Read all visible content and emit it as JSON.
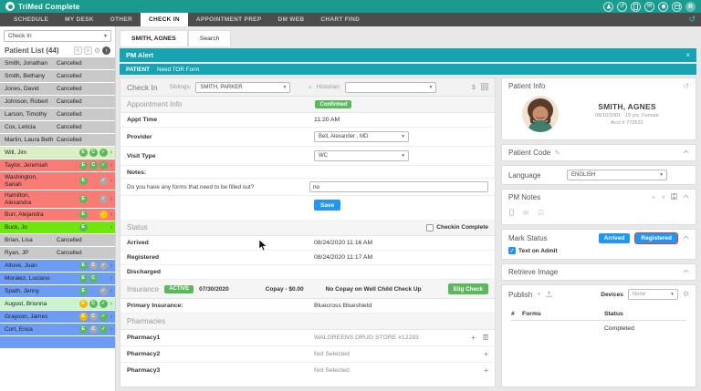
{
  "app": {
    "title": "TriMed Complete",
    "avatar": "R",
    "nav": [
      {
        "label": "SCHEDULE",
        "active": false
      },
      {
        "label": "MY DESK",
        "active": false
      },
      {
        "label": "OTHER",
        "active": false
      },
      {
        "label": "CHECK IN",
        "active": true
      },
      {
        "label": "APPOINTMENT PREP",
        "active": false
      },
      {
        "label": "DM WEB",
        "active": false
      },
      {
        "label": "CHART FIND",
        "active": false
      }
    ]
  },
  "icons": {
    "chevron_left": "‹",
    "chevron_right": "›",
    "gear": "⚙",
    "plus": "+",
    "close": "×",
    "dollar": "$",
    "edit": "✎",
    "mail": "✉",
    "mail_check": "☑",
    "history": "↺",
    "check": "✓",
    "caret": "▾",
    "chevron_up": "⌃"
  },
  "colors": {
    "rows": {
      "gray": "#c9c9c9",
      "red": "#f97b76",
      "lightgreen": "#daf0c4",
      "brightgreen": "#6fe70e",
      "palegreen": "#c9f4cf",
      "blue": "#6d9cf5"
    },
    "badges": {
      "green": "#5cb85c",
      "gray": "#a8a8a8",
      "orange": "#ffb300",
      "yellow": "#ffc107"
    },
    "accent_teal": "#1a9b8d",
    "alert_teal": "#17a3b2",
    "button_blue": "#2196f3",
    "button_green": "#5cb85c",
    "highlight_red": "#e53935"
  },
  "sidebar": {
    "filter_value": "Check In",
    "title": "Patient List (44)",
    "patients": [
      {
        "name": "Smith, Jonathan",
        "status": "Cancelled",
        "color": "gray"
      },
      {
        "name": "Smith, Bethany",
        "status": "Cancelled",
        "color": "gray"
      },
      {
        "name": "Jones, David",
        "status": "Cancelled",
        "color": "gray"
      },
      {
        "name": "Johnson, Robert",
        "status": "Cancelled",
        "color": "gray"
      },
      {
        "name": "Larson, Timothy",
        "status": "Cancelled",
        "color": "gray"
      },
      {
        "name": "Cox, Leticia",
        "status": "Cancelled",
        "color": "gray"
      },
      {
        "name": "Martin, Laura Beth",
        "status": "Cancelled",
        "color": "gray"
      },
      {
        "name": "Will, Jim",
        "color": "lightgreen",
        "arrow": true,
        "badges": [
          {
            "g": "E",
            "c": "green"
          },
          {
            "g": "C",
            "c": "green"
          },
          {
            "g": "check",
            "c": "green"
          }
        ]
      },
      {
        "name": "Taylor, Jeremiah",
        "color": "red",
        "arrow": true,
        "badges": [
          {
            "g": "E",
            "c": "green"
          },
          {
            "g": "C",
            "c": "green"
          },
          {
            "g": "check",
            "c": "green"
          }
        ]
      },
      {
        "name": "Washington, Sariah",
        "color": "red",
        "arrow": true,
        "badges": [
          {
            "g": "E",
            "c": "green"
          },
          null,
          {
            "g": "check",
            "c": "gray"
          }
        ]
      },
      {
        "name": "Hamilton, Alexandra",
        "color": "red",
        "arrow": true,
        "badges": [
          {
            "g": "E",
            "c": "green"
          },
          null,
          {
            "g": "check",
            "c": "gray"
          }
        ]
      },
      {
        "name": "Burr, Alejandra",
        "color": "red",
        "arrow": true,
        "badges": [
          {
            "g": "E",
            "c": "green"
          },
          null,
          {
            "g": "check",
            "c": "yellow"
          }
        ]
      },
      {
        "name": "Buck, Jo",
        "color": "brightgreen",
        "arrow": true,
        "badges": [
          {
            "g": "E",
            "c": "green"
          },
          null,
          null
        ]
      },
      {
        "name": "Brian, Lisa",
        "status": "Cancelled",
        "color": "gray"
      },
      {
        "name": "Ryan, JP",
        "status": "Cancelled",
        "color": "gray"
      },
      {
        "name": "Altuve, Juan",
        "color": "blue",
        "arrow": true,
        "badges": [
          {
            "g": "E",
            "c": "green"
          },
          {
            "g": "C",
            "c": "gray"
          },
          {
            "g": "check",
            "c": "gray"
          }
        ]
      },
      {
        "name": "Moralez, Luciano",
        "color": "blue",
        "arrow": true,
        "badges": [
          {
            "g": "E",
            "c": "green"
          },
          {
            "g": "C",
            "c": "green"
          },
          null
        ]
      },
      {
        "name": "Spath, Jenny",
        "color": "blue",
        "arrow": true,
        "badges": [
          {
            "g": "E",
            "c": "green"
          },
          null,
          {
            "g": "check",
            "c": "gray"
          }
        ]
      },
      {
        "name": "August, Brionna",
        "color": "palegreen",
        "arrow": true,
        "badges": [
          {
            "g": "E",
            "c": "orange"
          },
          {
            "g": "C",
            "c": "green"
          },
          {
            "g": "check",
            "c": "green"
          }
        ]
      },
      {
        "name": "Grayson, James",
        "color": "blue",
        "arrow": true,
        "badges": [
          {
            "g": "E",
            "c": "orange"
          },
          {
            "g": "C",
            "c": "gray"
          },
          {
            "g": "check",
            "c": "green"
          }
        ]
      },
      {
        "name": "Cort, Erica",
        "color": "blue",
        "arrow": true,
        "badges": [
          {
            "g": "E",
            "c": "green"
          },
          {
            "g": "C",
            "c": "gray"
          },
          {
            "g": "check",
            "c": "green"
          }
        ]
      },
      {
        "name": "",
        "color": "blue"
      }
    ]
  },
  "main": {
    "tabs": {
      "patient": "SMITH, AGNES",
      "search": "Search"
    },
    "pm_alert": {
      "title": "PM Alert",
      "category": "PATIENT",
      "message": "Need TOR Form"
    },
    "checkin": {
      "title": "Check In",
      "siblings_label": "Siblings:",
      "siblings_value": "SMITH, PARKER",
      "historian_label": "Historian:",
      "historian_value": ""
    },
    "appointment": {
      "title": "Appointment Info",
      "badge": "Confirmed",
      "appt_time_label": "Appt Time",
      "appt_time": "11:20 AM",
      "provider_label": "Provider",
      "provider": "Bell, Alexander , MD",
      "visit_type_label": "Visit Type",
      "visit_type": "WC",
      "notes_label": "Notes:",
      "question": "Do you have any forms that need to be filled out?",
      "answer": "no",
      "save_label": "Save"
    },
    "status": {
      "title": "Status",
      "checkbox_label": "Checkin Complete",
      "rows": [
        {
          "label": "Arrived",
          "value": "08/24/2020 11:16 AM"
        },
        {
          "label": "Registered",
          "value": "08/24/2020 11:17 AM"
        },
        {
          "label": "Discharged",
          "value": ""
        }
      ]
    },
    "insurance": {
      "title": "Insurance",
      "badge": "ACTIVE",
      "date": "07/30/2020",
      "copay": "Copay - $0.00",
      "note": "No Copay on Well Child Check Up",
      "elig_label": "Elig Check",
      "primary_label": "Primary Insurance:",
      "primary_value": "Bluecross Blueshield"
    },
    "pharmacies": {
      "title": "Pharmacies",
      "rows": [
        {
          "label": "Pharmacy1",
          "value": "WALGREENS DRUG STORE #12283"
        },
        {
          "label": "Pharmacy2",
          "value": "Not Selected"
        },
        {
          "label": "Pharmacy3",
          "value": "Not Selected"
        }
      ]
    }
  },
  "right": {
    "patient_info": {
      "title": "Patient Info",
      "name": "SMITH, AGNES",
      "dob": "08/10/2001",
      "age_sex": "19 yrs. Female",
      "acct": "Acct # 773531"
    },
    "patient_code": {
      "title": "Patient Code"
    },
    "language": {
      "label": "Language",
      "value": "ENGLISH"
    },
    "pm_notes": {
      "title": "PM Notes"
    },
    "mark_status": {
      "title": "Mark Status",
      "arrived_label": "Arrived",
      "registered_label": "Registered",
      "checkbox_label": "Text on Admit"
    },
    "retrieve_image": {
      "title": "Retrieve Image"
    },
    "publish": {
      "title": "Publish",
      "devices_label": "Devices",
      "devices_value": "None"
    },
    "forms": {
      "col_num": "#",
      "col_forms": "Forms",
      "col_status": "Status",
      "rows": [
        {
          "forms": "",
          "status": "Completed"
        }
      ]
    }
  }
}
